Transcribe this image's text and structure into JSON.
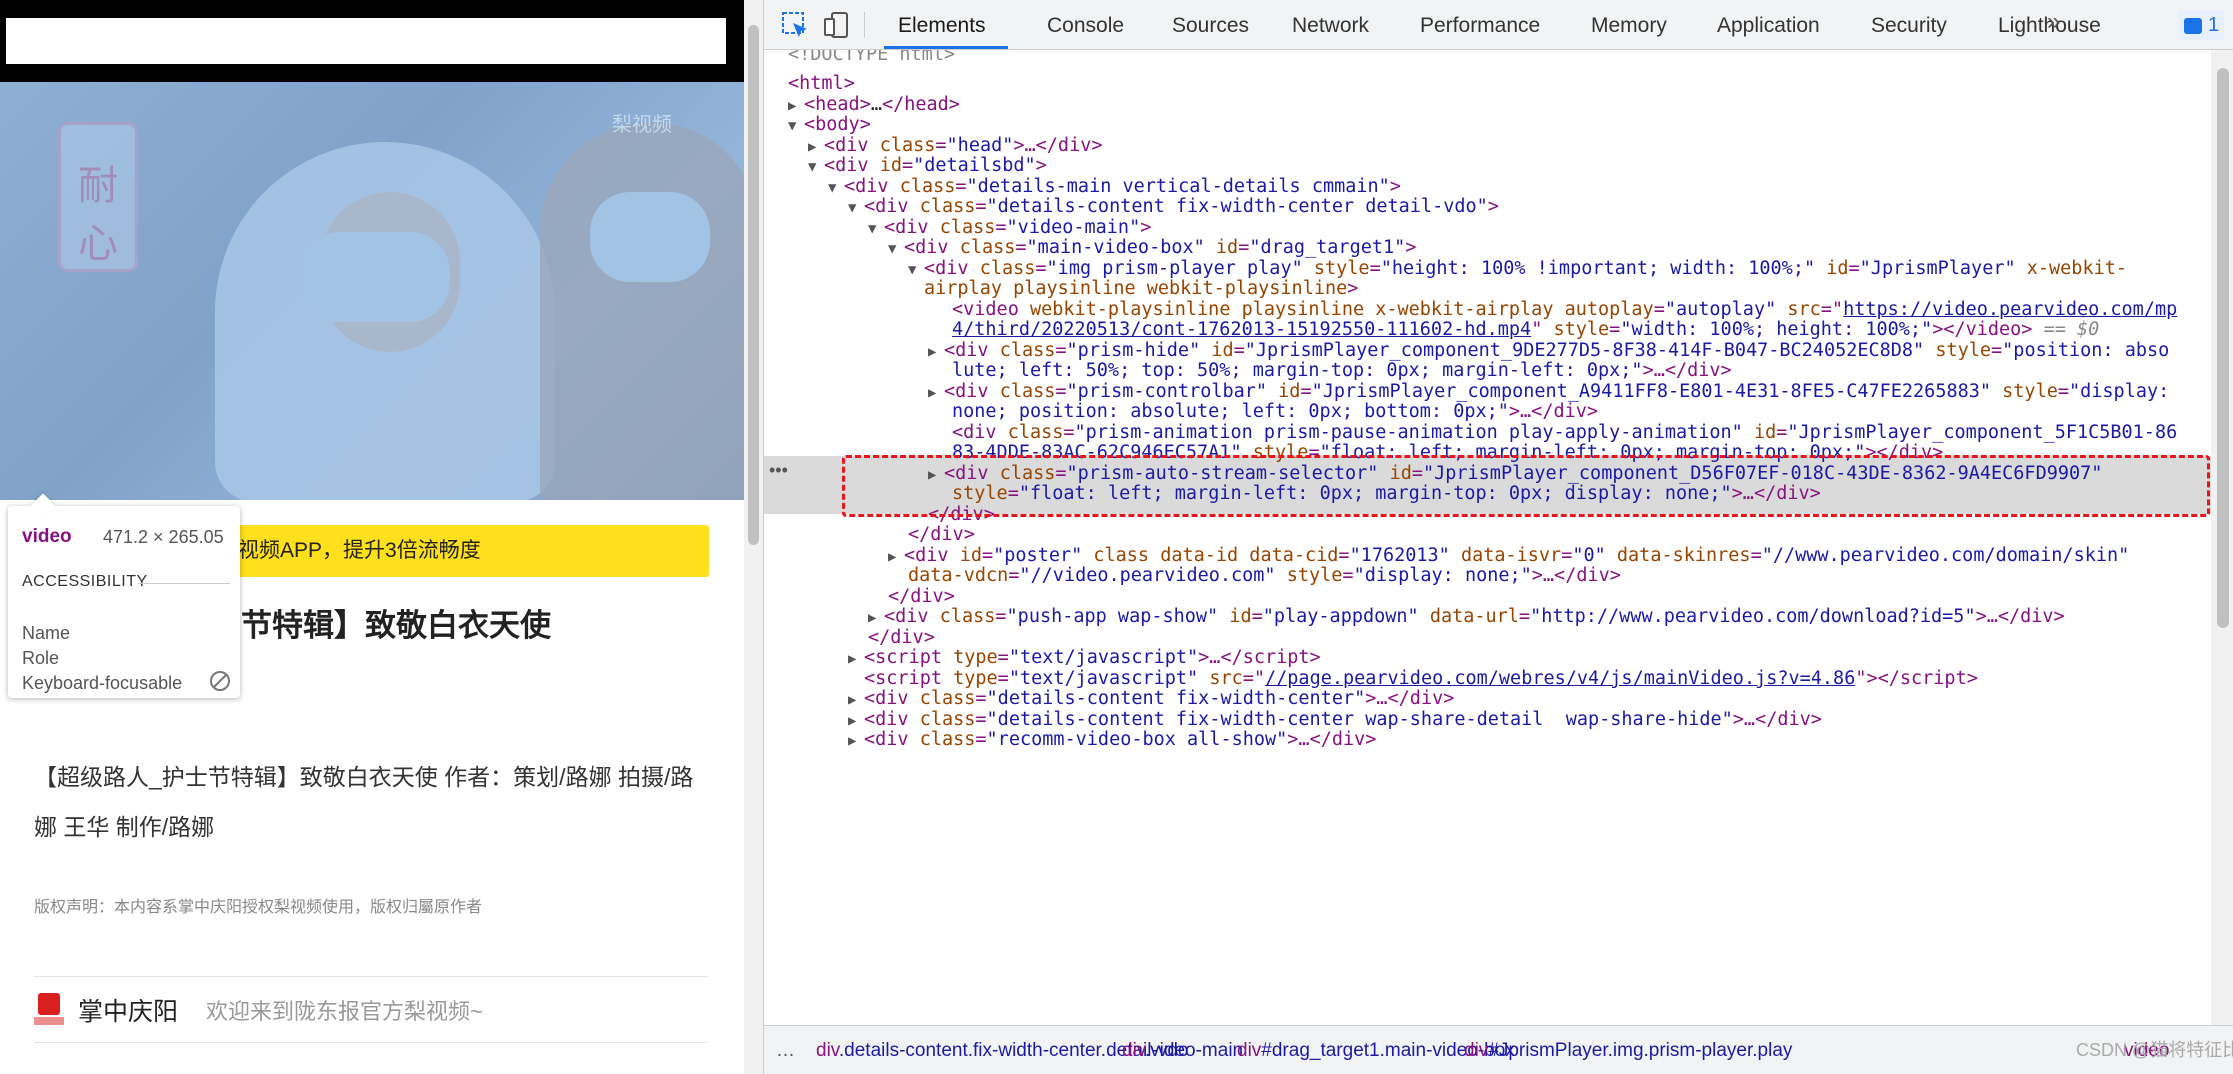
{
  "preview": {
    "watermark": "梨视频",
    "logo_text": "耐心",
    "banner": "开梨视频APP，提升3倍流畅度",
    "title": "士节特辑】致敬白衣天使",
    "description": "【超级路人_护士节特辑】致敬白衣天使 作者：策划/路娜 拍摄/路娜 王华 制作/路娜",
    "copyright": "版权声明：本内容系掌中庆阳授权梨视频使用，版权归屬原作者",
    "author_name": "掌中庆阳",
    "author_desc": "欢迎来到陇东报官方梨视频~"
  },
  "tooltip": {
    "tag": "video",
    "size": "471.2 × 265.05",
    "section": "ACCESSIBILITY",
    "rows": [
      "Name",
      "Role",
      "Keyboard-focusable"
    ]
  },
  "devtools": {
    "tabs": [
      "Elements",
      "Console",
      "Sources",
      "Network",
      "Performance",
      "Memory",
      "Application",
      "Security",
      "Lighthouse"
    ],
    "active_tab": "Elements",
    "more": "»",
    "issues_count": "1",
    "code": {
      "l0": "<!DOCTYPE html>",
      "l1_tag": "<html>",
      "l2_tag": "<head>",
      "l2_rest": "…",
      "l2_close": "</head>",
      "l3_tag": "<body>",
      "l4_open": "<div ",
      "l4_an": "class",
      "l4_av": "\"head\"",
      "l4_rest": ">…</div>",
      "l5_open": "<div ",
      "l5_an": "id",
      "l5_av": "\"detailsbd\"",
      "l5_close": ">",
      "l6_an": "class",
      "l6_av": "\"details-main vertical-details cmmain\"",
      "l7_av": "\"details-content fix-width-center detail-vdo\"",
      "l8_av": "\"video-main\"",
      "l9_av": "\"main-video-box\"",
      "l9_id": "\"drag_target1\"",
      "l10_av": "\"img prism-player play\"",
      "l10_style": "\"height: 100% !important; width: 100%;\"",
      "l10_id": "\"JprismPlayer\"",
      "l10_flags1": "x-webkit-",
      "l10_flags2": "airplay playsinline webkit-playsinline",
      "video_flags": "webkit-playsinline playsinline x-webkit-airplay",
      "video_autoplay": "\"autoplay\"",
      "video_src1": "https://video.pearvideo.com/mp",
      "video_src2": "4/third/20220513/cont-1762013-15192550-111602-hd.mp4",
      "video_style": "\"width: 100%; height: 100%;\"",
      "video_dollar": "== $0",
      "l13_av": "\"prism-hide\"",
      "l13_id": "\"JprismPlayer_component_9DE277D5-8F38-414F-B047-BC24052EC8D8\"",
      "l13_style1": "\"position: abso",
      "l13_style2": "lute; left: 50%; top: 50%; margin-top: 0px; margin-left: 0px;\"",
      "l15_av": "\"prism-controlbar\"",
      "l15_id": "\"JprismPlayer_component_A9411FF8-E801-4E31-8FE5-C47FE2265883\"",
      "l15_style1": "\"display:",
      "l15_style2": "none; position: absolute; left: 0px; bottom: 0px;\"",
      "l17_av": "\"prism-animation prism-pause-animation play-apply-animation\"",
      "l17_id1": "\"JprismPlayer_component_5F1C5B01-86",
      "l17_id2": "83-4DDE-83AC-62C946EC57A1\"",
      "l17_style": "\"float: left; margin-left: 0px; margin-top: 0px;\"",
      "l19_av": "\"prism-auto-stream-selector\"",
      "l19_id": "\"JprismPlayer_component_D56F07EF-018C-43DE-8362-9A4EC6FD9907\"",
      "l19_style": "\"float: left; margin-left: 0px; margin-top: 0px; display: none;\"",
      "close_div": "</div>",
      "l24_id": "\"poster\"",
      "l24_cid": "\"1762013\"",
      "l24_isvr": "\"0\"",
      "l24_skin": "\"//www.pearvideo.com/domain/skin\"",
      "l25_vdcn": "\"//video.pearvideo.com\"",
      "l25_style": "\"display: none;\"",
      "l27_av": "\"push-app wap-show\"",
      "l27_id": "\"play-appdown\"",
      "l27_url": "\"http://www.pearvideo.com/download?id=5\"",
      "l29_type": "\"text/javascript\"",
      "l30_src": "//page.pearvideo.com/webres/v4/js/mainVideo.js?v=4.86",
      "l31_av": "\"details-content fix-width-center\"",
      "l32_av": "\"details-content fix-width-center wap-share-detail  wap-share-hide\"",
      "l33_partial": "\"recomm-video-box all-show\""
    },
    "breadcrumb": {
      "dots": "…",
      "items": [
        {
          "tag": "div",
          "rest": ".details-content.fix-width-center.detail-vdo"
        },
        {
          "tag": "div",
          "rest": ".video-main"
        },
        {
          "tag": "div",
          "rest": "#drag_target1.main-video-box"
        },
        {
          "tag": "div",
          "rest": "#JprismPlayer.img.prism-player.play"
        },
        {
          "tag": "video",
          "rest": ""
        }
      ],
      "watermark": "CSDN @猫将特征比李肚"
    }
  },
  "colors": {
    "tag": "#881280",
    "attr_name": "#994500",
    "attr_value": "#1a1aa6",
    "highlight_border": "#e8161b",
    "tab_underline": "#1a73e8",
    "banner_bg": "#ffe01a"
  }
}
